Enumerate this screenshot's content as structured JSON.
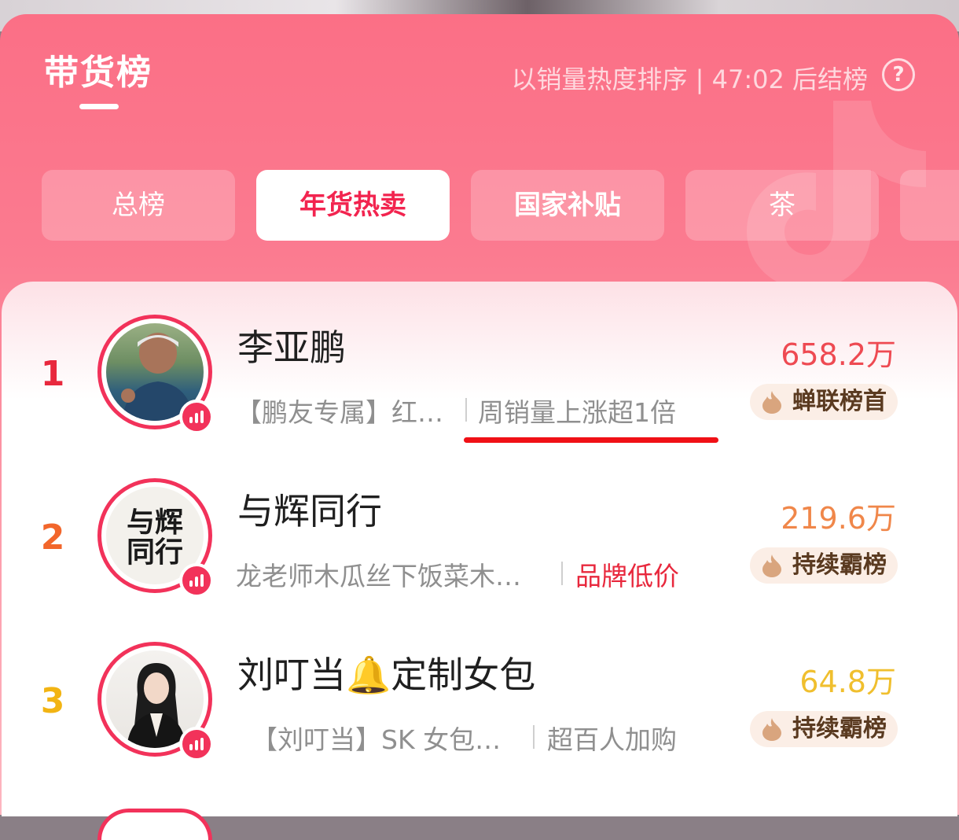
{
  "header": {
    "title": "带货榜",
    "sort_info": "以销量热度排序 | 47:02 后结榜",
    "help_icon": "question-circle-icon"
  },
  "tabs": [
    {
      "label": "总榜",
      "active": false
    },
    {
      "label": "年货热卖",
      "active": true
    },
    {
      "label": "国家补贴",
      "active": false
    },
    {
      "label": "茶",
      "active": false
    },
    {
      "label": "",
      "active": false
    }
  ],
  "rankings": [
    {
      "rank": "1",
      "name": "李亚鹏",
      "product": "【鹏友专属】红…",
      "tag": "周销量上涨超1倍",
      "sales": "658.2万",
      "honor": "蝉联榜首",
      "rank_color": "#e8283d",
      "tag_color": "#8f8f8f",
      "sales_color": "#ee4a52"
    },
    {
      "rank": "2",
      "name": "与辉同行",
      "product": "龙老师木瓜丝下饭菜木…",
      "tag": "品牌低价",
      "sales": "219.6万",
      "honor": "持续霸榜",
      "rank_color": "#f2662b",
      "tag_color": "#e8283d",
      "sales_color": "#f0874a",
      "avatar_text": "与辉同行"
    },
    {
      "rank": "3",
      "name": "刘叮当🔔定制女包",
      "product": "【刘叮当】SK 女包…",
      "tag": "超百人加购",
      "sales": "64.8万",
      "honor": "持续霸榜",
      "rank_color": "#f2b413",
      "tag_color": "#8f8f8f",
      "sales_color": "#f0bf2e"
    }
  ],
  "icons": {
    "live_badge": "live-bars-icon",
    "honor": "flame-icon",
    "watermark": "tiktok-note-icon"
  },
  "colors": {
    "accent": "#f2325a",
    "header_bg": "#fb6f86"
  }
}
